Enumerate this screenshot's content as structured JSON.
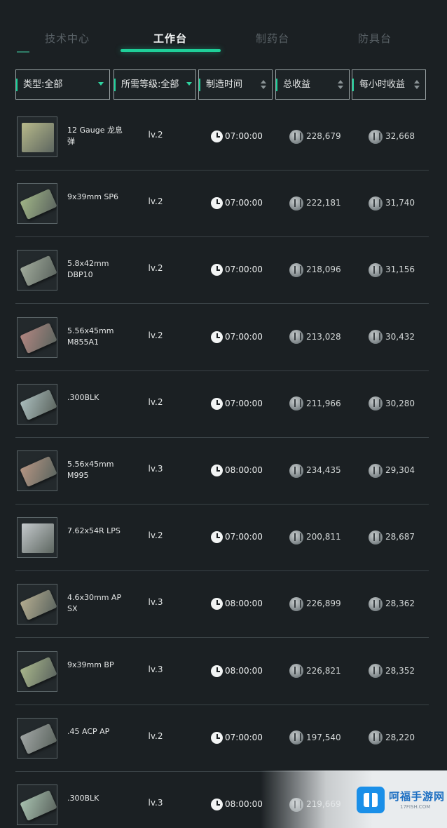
{
  "tabs": [
    {
      "label": "技术中心",
      "active": false
    },
    {
      "label": "工作台",
      "active": true
    },
    {
      "label": "制药台",
      "active": false
    },
    {
      "label": "防具台",
      "active": false
    }
  ],
  "filters": {
    "type": "类型:全部",
    "level": "所需等级:全部",
    "time": "制造时间",
    "total": "总收益",
    "hourly": "每小时收益"
  },
  "items": [
    {
      "name": "12 Gauge 龙息弹",
      "level": "lv.2",
      "time": "07:00:00",
      "total": "228,679",
      "hourly": "32,668",
      "thumb_style": "box",
      "thumb_color": "#b7b98a"
    },
    {
      "name": "9x39mm SP6",
      "level": "lv.2",
      "time": "07:00:00",
      "total": "222,181",
      "hourly": "31,740",
      "thumb_style": "card",
      "thumb_color": "#9fb486"
    },
    {
      "name": "5.8x42mm DBP10",
      "level": "lv.2",
      "time": "07:00:00",
      "total": "218,096",
      "hourly": "31,156",
      "thumb_style": "card",
      "thumb_color": "#9fa99a"
    },
    {
      "name": "5.56x45mm M855A1",
      "level": "lv.2",
      "time": "07:00:00",
      "total": "213,028",
      "hourly": "30,432",
      "thumb_style": "card",
      "thumb_color": "#b08580"
    },
    {
      "name": ".300BLK",
      "level": "lv.2",
      "time": "07:00:00",
      "total": "211,966",
      "hourly": "30,280",
      "thumb_style": "card",
      "thumb_color": "#a9bcbc"
    },
    {
      "name": "5.56x45mm M995",
      "level": "lv.3",
      "time": "08:00:00",
      "total": "234,435",
      "hourly": "29,304",
      "thumb_style": "card",
      "thumb_color": "#b49482"
    },
    {
      "name": "7.62x54R LPS",
      "level": "lv.2",
      "time": "07:00:00",
      "total": "200,811",
      "hourly": "28,687",
      "thumb_style": "box",
      "thumb_color": "#c4c9cc"
    },
    {
      "name": "4.6x30mm AP SX",
      "level": "lv.3",
      "time": "08:00:00",
      "total": "226,899",
      "hourly": "28,362",
      "thumb_style": "card",
      "thumb_color": "#b3ab8f"
    },
    {
      "name": "9x39mm BP",
      "level": "lv.3",
      "time": "08:00:00",
      "total": "226,821",
      "hourly": "28,352",
      "thumb_style": "card",
      "thumb_color": "#a7b58a"
    },
    {
      "name": ".45 ACP AP",
      "level": "lv.2",
      "time": "07:00:00",
      "total": "197,540",
      "hourly": "28,220",
      "thumb_style": "card",
      "thumb_color": "#9fa4a3"
    },
    {
      "name": ".300BLK",
      "level": "lv.3",
      "time": "08:00:00",
      "total": "219,669",
      "hourly": "",
      "thumb_style": "card",
      "thumb_color": "#a6c0ae"
    }
  ],
  "watermark": {
    "title": "呵福手游网",
    "subtitle": "17FISH.COM"
  }
}
